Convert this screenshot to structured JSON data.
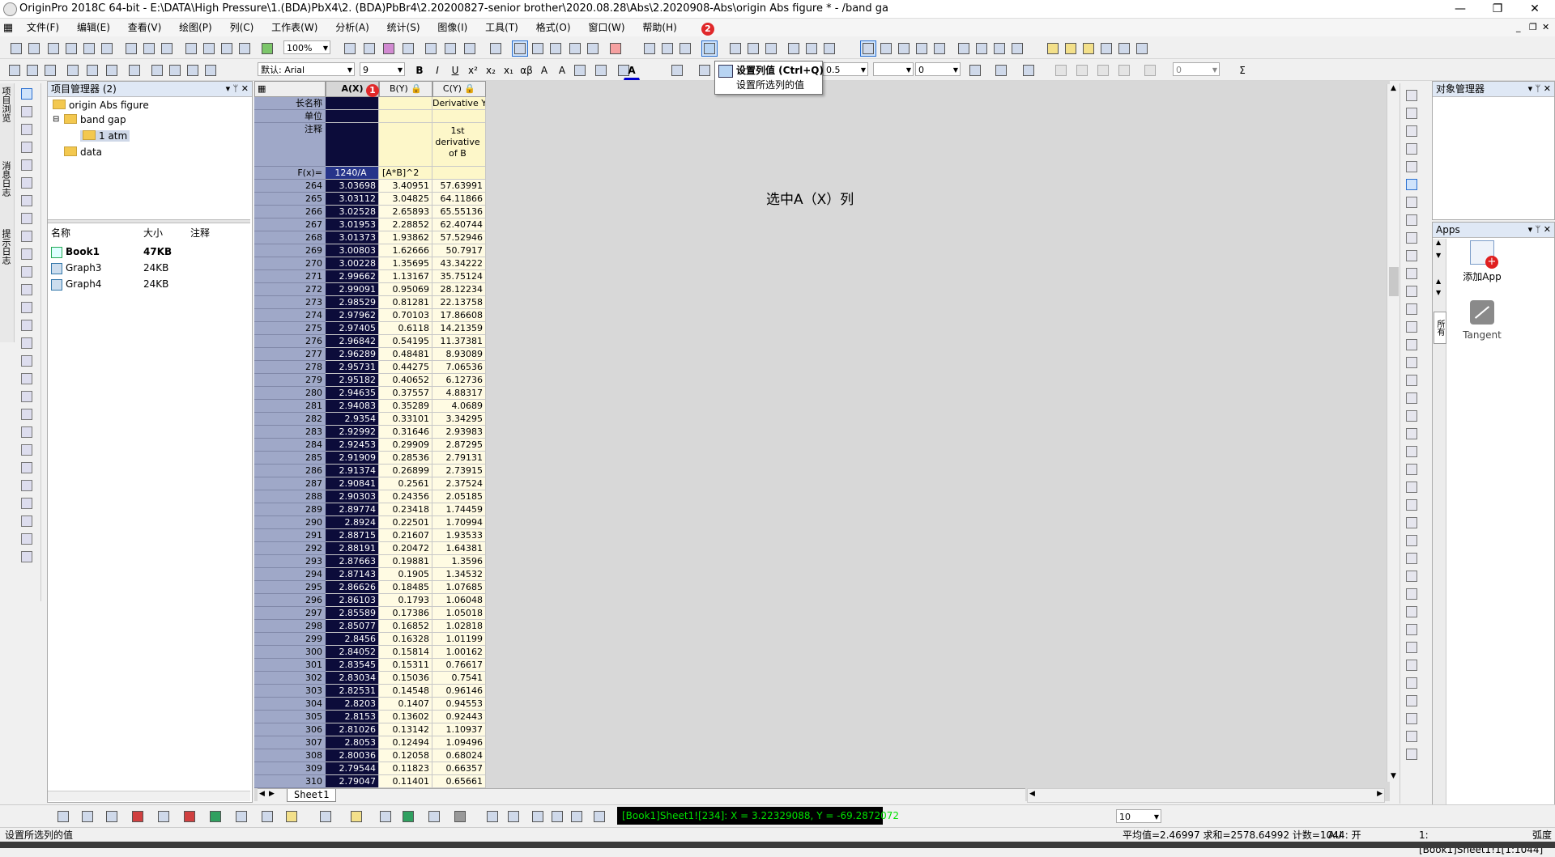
{
  "titlebar": {
    "title": "OriginPro 2018C 64-bit - E:\\DATA\\High Pressure\\1.(BDA)PbX4\\2.  (BDA)PbBr4\\2.20200827-senior brother\\2020.08.28\\Abs\\2.2020908-Abs\\origin Abs figure * - /band ga",
    "minimize": "—",
    "restore": "❐",
    "close": "✕"
  },
  "menubar": {
    "items": [
      "文件(F)",
      "编辑(E)",
      "查看(V)",
      "绘图(P)",
      "列(C)",
      "工作表(W)",
      "分析(A)",
      "统计(S)",
      "图像(I)",
      "工具(T)",
      "格式(O)",
      "窗口(W)",
      "帮助(H)"
    ],
    "right_controls": [
      "_",
      "❐",
      "✕"
    ]
  },
  "toolbar": {
    "zoom": "100%",
    "font_name": "默认: Arial",
    "font_size": "9",
    "line_width": "0.5",
    "num_a": "0",
    "num_b": "0",
    "tb3_num": "10"
  },
  "tooltip": {
    "title": "设置列值 (Ctrl+Q)",
    "desc": "设置所选列的值"
  },
  "badges": {
    "one": "1",
    "two": "2"
  },
  "left_vertical_tabs": [
    "项目浏览",
    "消息日志",
    "提示日志"
  ],
  "project_manager": {
    "header": "项目管理器 (2)",
    "controls": [
      "▾",
      "ᛘ",
      "✕"
    ],
    "tree": [
      {
        "label": "origin Abs figure"
      },
      {
        "label": "band gap"
      },
      {
        "label": "1 atm"
      },
      {
        "label": "data"
      }
    ],
    "tree_toggles": [
      "⊟",
      "⊟"
    ],
    "file_columns": [
      "名称",
      "大小",
      "注释"
    ],
    "files": [
      {
        "name": "Book1",
        "size": "47KB"
      },
      {
        "name": "Graph3",
        "size": "24KB"
      },
      {
        "name": "Graph4",
        "size": "24KB"
      }
    ]
  },
  "worksheet": {
    "corner_label": "▦",
    "columns": [
      {
        "header": "A(X)",
        "long_name": "",
        "units": "",
        "comment": "",
        "formula": "1240/A"
      },
      {
        "header": "B(Y)",
        "long_name": "",
        "units": "",
        "comment": "",
        "formula": "[A*B]^2"
      },
      {
        "header": "C(Y)",
        "long_name": "Derivative Y",
        "units": "",
        "comment": "1st\nderivative\nof B",
        "formula": ""
      }
    ],
    "meta_labels": {
      "long_name": "长名称",
      "units": "单位",
      "comment": "注释",
      "formula": "F(x)="
    },
    "rows": [
      [
        "264",
        "3.03698",
        "3.40951",
        "57.63991"
      ],
      [
        "265",
        "3.03112",
        "3.04825",
        "64.11866"
      ],
      [
        "266",
        "3.02528",
        "2.65893",
        "65.55136"
      ],
      [
        "267",
        "3.01953",
        "2.28852",
        "62.40744"
      ],
      [
        "268",
        "3.01373",
        "1.93862",
        "57.52946"
      ],
      [
        "269",
        "3.00803",
        "1.62666",
        "50.7917"
      ],
      [
        "270",
        "3.00228",
        "1.35695",
        "43.34222"
      ],
      [
        "271",
        "2.99662",
        "1.13167",
        "35.75124"
      ],
      [
        "272",
        "2.99091",
        "0.95069",
        "28.12234"
      ],
      [
        "273",
        "2.98529",
        "0.81281",
        "22.13758"
      ],
      [
        "274",
        "2.97962",
        "0.70103",
        "17.86608"
      ],
      [
        "275",
        "2.97405",
        "0.6118",
        "14.21359"
      ],
      [
        "276",
        "2.96842",
        "0.54195",
        "11.37381"
      ],
      [
        "277",
        "2.96289",
        "0.48481",
        "8.93089"
      ],
      [
        "278",
        "2.95731",
        "0.44275",
        "7.06536"
      ],
      [
        "279",
        "2.95182",
        "0.40652",
        "6.12736"
      ],
      [
        "280",
        "2.94635",
        "0.37557",
        "4.88317"
      ],
      [
        "281",
        "2.94083",
        "0.35289",
        "4.0689"
      ],
      [
        "282",
        "2.9354",
        "0.33101",
        "3.34295"
      ],
      [
        "283",
        "2.92992",
        "0.31646",
        "2.93983"
      ],
      [
        "284",
        "2.92453",
        "0.29909",
        "2.87295"
      ],
      [
        "285",
        "2.91909",
        "0.28536",
        "2.79131"
      ],
      [
        "286",
        "2.91374",
        "0.26899",
        "2.73915"
      ],
      [
        "287",
        "2.90841",
        "0.2561",
        "2.37524"
      ],
      [
        "288",
        "2.90303",
        "0.24356",
        "2.05185"
      ],
      [
        "289",
        "2.89774",
        "0.23418",
        "1.74459"
      ],
      [
        "290",
        "2.8924",
        "0.22501",
        "1.70994"
      ],
      [
        "291",
        "2.88715",
        "0.21607",
        "1.93533"
      ],
      [
        "292",
        "2.88191",
        "0.20472",
        "1.64381"
      ],
      [
        "293",
        "2.87663",
        "0.19881",
        "1.3596"
      ],
      [
        "294",
        "2.87143",
        "0.1905",
        "1.34532"
      ],
      [
        "295",
        "2.86626",
        "0.18485",
        "1.07685"
      ],
      [
        "296",
        "2.86103",
        "0.1793",
        "1.06048"
      ],
      [
        "297",
        "2.85589",
        "0.17386",
        "1.05018"
      ],
      [
        "298",
        "2.85077",
        "0.16852",
        "1.02818"
      ],
      [
        "299",
        "2.8456",
        "0.16328",
        "1.01199"
      ],
      [
        "300",
        "2.84052",
        "0.15814",
        "1.00162"
      ],
      [
        "301",
        "2.83545",
        "0.15311",
        "0.76617"
      ],
      [
        "302",
        "2.83034",
        "0.15036",
        "0.7541"
      ],
      [
        "303",
        "2.82531",
        "0.14548",
        "0.96146"
      ],
      [
        "304",
        "2.8203",
        "0.1407",
        "0.94553"
      ],
      [
        "305",
        "2.8153",
        "0.13602",
        "0.92443"
      ],
      [
        "306",
        "2.81026",
        "0.13142",
        "1.10937"
      ],
      [
        "307",
        "2.8053",
        "0.12494",
        "1.09496"
      ],
      [
        "308",
        "2.80036",
        "0.12058",
        "0.68024"
      ],
      [
        "309",
        "2.79544",
        "0.11823",
        "0.66357"
      ],
      [
        "310",
        "2.79047",
        "0.11401",
        "0.65661"
      ]
    ],
    "annotation": "选中A（X）列",
    "sheet_tab": "Sheet1",
    "sheet_nav": [
      "◀",
      "▶"
    ],
    "hscroll_arrows": [
      "◀",
      "▶"
    ],
    "vscroll_arrows": [
      "▲",
      "▼"
    ]
  },
  "object_manager": {
    "header": "对象管理器",
    "controls": [
      "▾",
      "ᛘ",
      "✕"
    ]
  },
  "apps_panel": {
    "header": "Apps",
    "controls": [
      "▾",
      "ᛘ",
      "✕"
    ],
    "side_tab": "所有",
    "items": [
      {
        "label": "添加App",
        "icon": "add-app-icon"
      },
      {
        "label": "Tangent",
        "icon": "tangent-icon"
      }
    ]
  },
  "coordinates": "[Book1]Sheet1![234]:  X = 3.22329088, Y = -69.2872072",
  "statusbar": {
    "left": "设置所选列的值",
    "stats": "平均值=2.46997 求和=2578.64992 计数=1044",
    "au": "AU : 开",
    "ref": "1: [Book1]Sheet1!1[1:1044]",
    "unit": "弧度"
  }
}
